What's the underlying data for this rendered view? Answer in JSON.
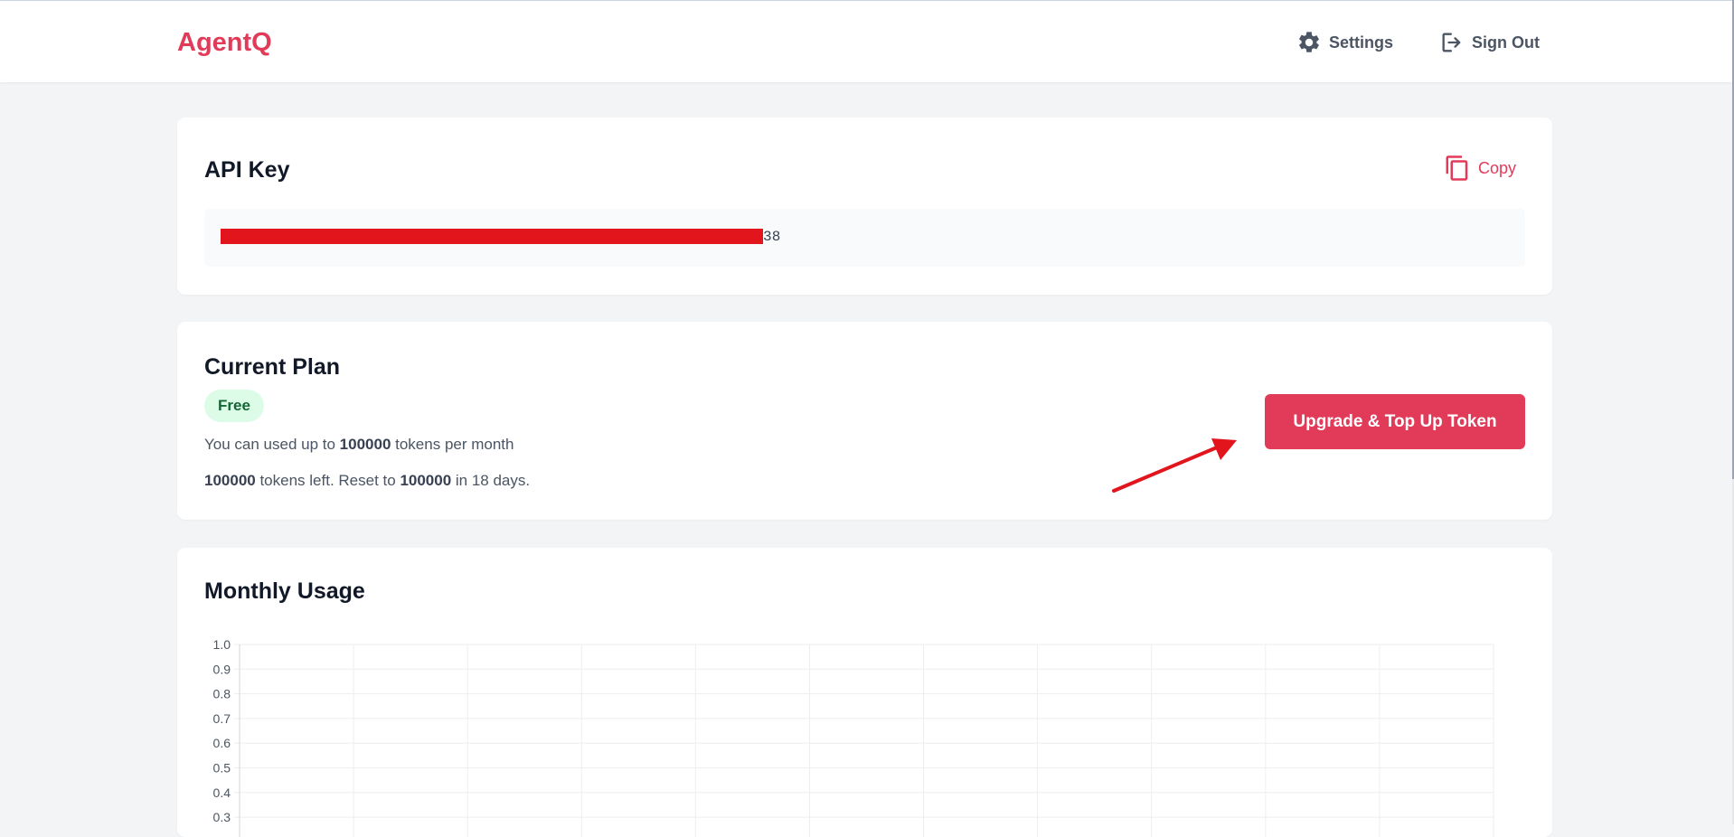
{
  "header": {
    "brand": "AgentQ",
    "settings_label": "Settings",
    "signout_label": "Sign Out",
    "settings_icon": "gear-icon",
    "signout_icon": "sign-out-icon"
  },
  "api_key": {
    "title": "API Key",
    "copy_label": "Copy",
    "copy_icon": "copy-icon",
    "value_visible_suffix": "38"
  },
  "plan": {
    "title": "Current Plan",
    "badge": "Free",
    "line1_prefix": "You can used up to ",
    "line1_amount": "100000",
    "line1_suffix": " tokens per month",
    "line2_left": "100000",
    "line2_mid": " tokens left. Reset to ",
    "line2_reset": "100000",
    "line2_suffix": " in 18 days.",
    "upgrade_label": "Upgrade & Top Up Token"
  },
  "usage": {
    "title": "Monthly Usage"
  },
  "chart_data": {
    "type": "line",
    "title": "",
    "xlabel": "",
    "ylabel": "",
    "y_ticks_visible": [
      "1.0",
      "0.9",
      "0.8",
      "0.7",
      "0.6",
      "0.5",
      "0.4",
      "0.3"
    ],
    "ylim": [
      0,
      1.0
    ],
    "grid": true,
    "series": []
  },
  "colors": {
    "brand": "#e23b5a",
    "badge_bg": "#dcfce7",
    "badge_text": "#166534",
    "annotation_arrow": "#e2141c"
  }
}
